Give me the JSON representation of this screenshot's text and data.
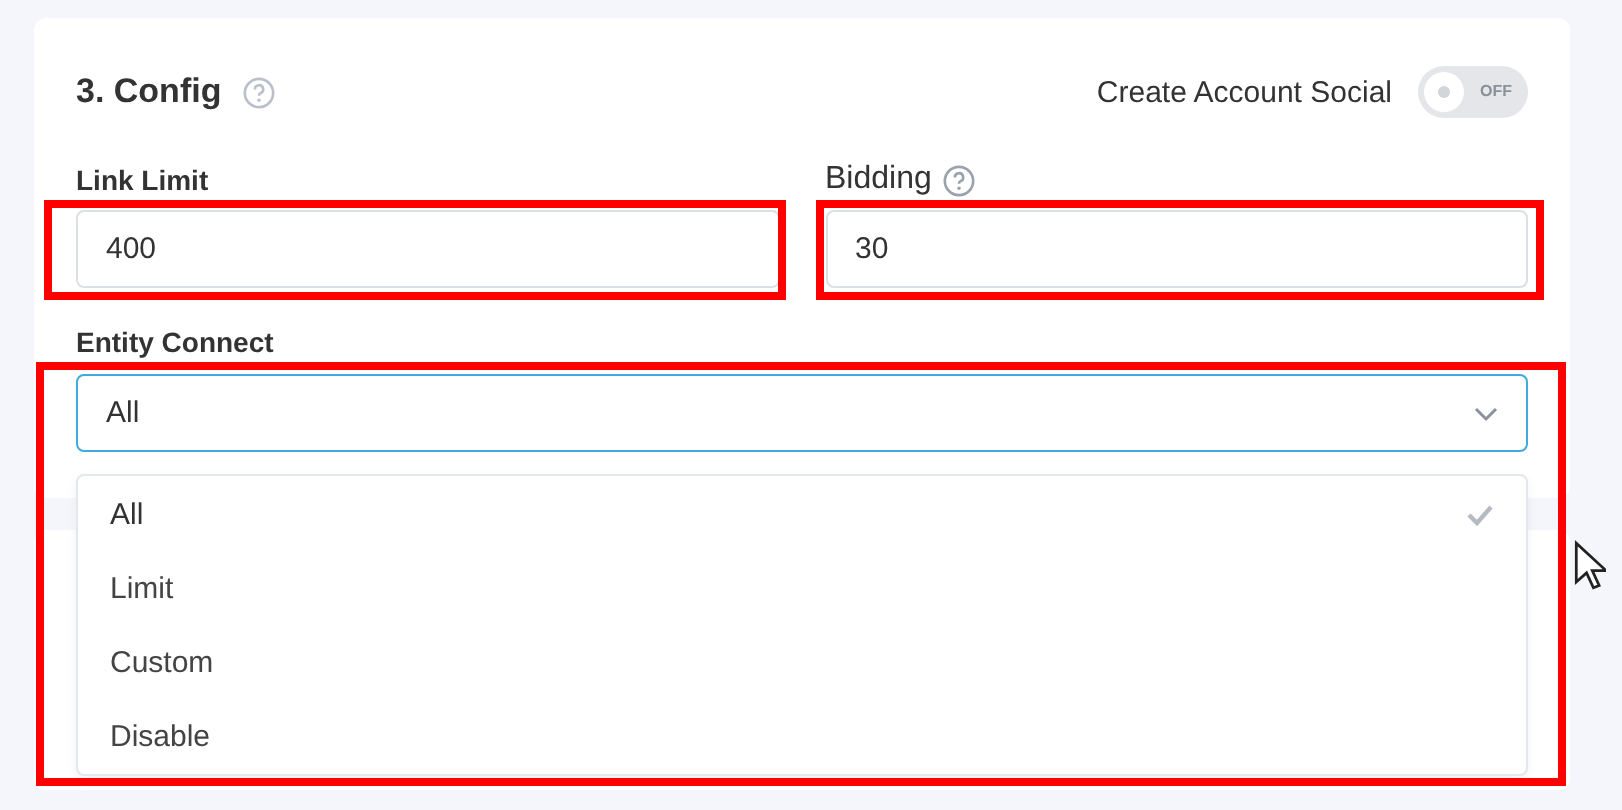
{
  "section": {
    "title": "3. Config",
    "help": true
  },
  "create_account_social": {
    "label": "Create Account Social",
    "on": false,
    "state_text": "OFF"
  },
  "link_limit": {
    "label": "Link Limit",
    "value": "400",
    "highlighted": true
  },
  "bidding": {
    "label": "Bidding",
    "help": true,
    "value": "30",
    "highlighted": true
  },
  "entity_connect": {
    "label": "Entity Connect",
    "value": "All",
    "expanded": true,
    "highlighted": true,
    "options": [
      {
        "label": "All",
        "selected": true
      },
      {
        "label": "Limit",
        "selected": false
      },
      {
        "label": "Custom",
        "selected": false
      },
      {
        "label": "Disable",
        "selected": false
      }
    ]
  }
}
